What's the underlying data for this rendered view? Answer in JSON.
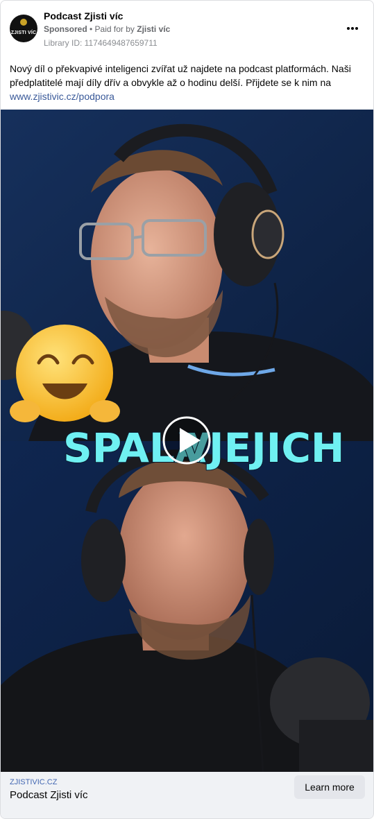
{
  "post": {
    "page_name": "Podcast Zjisti víc",
    "sponsored": "Sponsored",
    "paid_prefix": " • Paid for by ",
    "paid_by": "Zjisti víc",
    "library_id": "Library ID: 1174649487659711",
    "body": "Nový díl o překvapivé inteligenci zvířat už najdete na podcast platformách. Naši předplatitelé mají díly dřív a obvykle až o hodinu delší. Přijdete se k nim na",
    "link": "www.zjistivic.cz/podpora",
    "avatar_text": "ZJISTI VÍC"
  },
  "media": {
    "caption_left": "SPALA",
    "caption_mid": "V",
    "caption_right": "JEJICH",
    "emoji": "🤗"
  },
  "footer": {
    "domain": "ZJISTIVIC.CZ",
    "title": "Podcast Zjisti víc",
    "cta": "Learn more"
  },
  "colors": {
    "accent": "#385898",
    "caption": "#6ff0f2",
    "backdrop": "#0e2448"
  }
}
